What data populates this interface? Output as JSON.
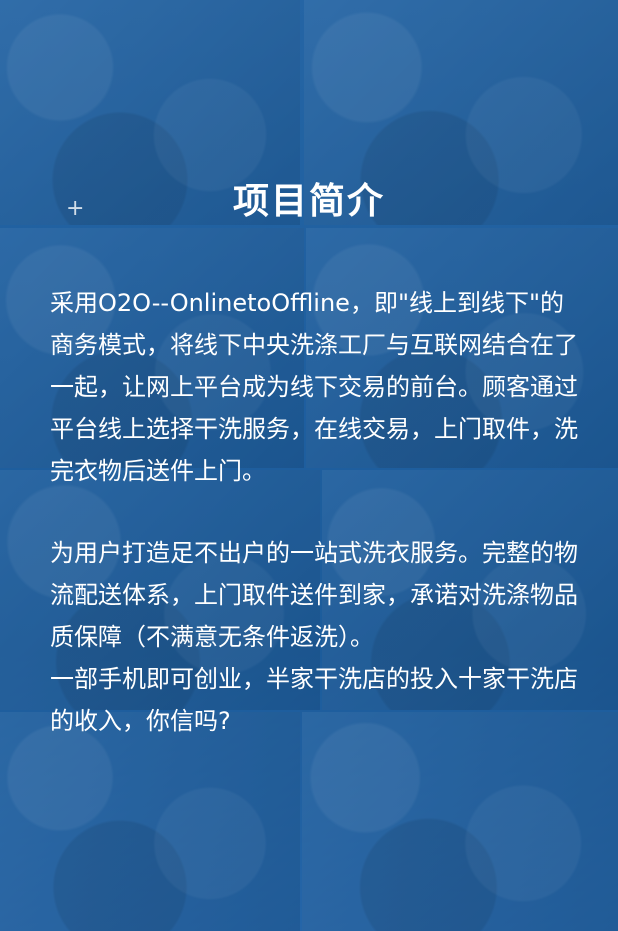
{
  "title": "项目简介",
  "paragraph1": "采用O2O--OnlinetoOffline，即\"线上到线下\"的商务模式，将线下中央洗涤工厂与互联网结合在了一起，让网上平台成为线下交易的前台。顾客通过平台线上选择干洗服务，在线交易，上门取件，洗完衣物后送件上门。",
  "paragraph2": "为用户打造足不出户的一站式洗衣服务。完整的物流配送体系，上门取件送件到家，承诺对洗涤物品质保障（不满意无条件返洗）。",
  "paragraph3": "一部手机即可创业，半家干洗店的投入十家干洗店的收入，你信吗?",
  "decor": {
    "plus": "+",
    "accent": "#1f5f9f"
  }
}
